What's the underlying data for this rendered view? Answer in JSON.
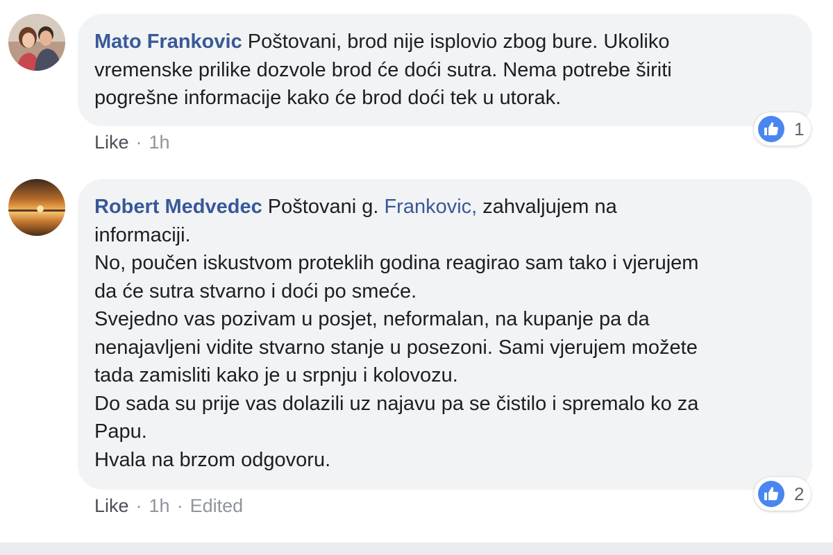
{
  "comments": [
    {
      "author": "Mato Frankovic",
      "lines": [
        "Poštovani, brod nije isplovio zbog bure. Ukoliko",
        "vremenske prilike dozvole brod će doći sutra. Nema potrebe širiti",
        "pogrešne informacije kako će brod doći tek u utorak."
      ],
      "like_label": "Like",
      "separator": "·",
      "time": "1h",
      "reaction_icon": "like-thumb-icon",
      "reaction_count": "1"
    },
    {
      "author": "Robert Medvedec",
      "first_line_pre": "Poštovani g.",
      "mention": "Frankovic,",
      "first_line_post": "zahvaljujem na",
      "lines": [
        "informaciji.",
        "No, poučen iskustvom proteklih godina reagirao sam tako i vjerujem",
        "da će sutra stvarno i doći po smeće.",
        "Svejedno vas pozivam u posjet, neformalan, na kupanje pa da",
        "nenajavljeni vidite stvarno stanje u posezoni. Sami vjerujem možete",
        "tada zamisliti kako je u srpnju i kolovozu.",
        "Do sada su prije vas dolazili uz najavu pa se čistilo i spremalo ko za",
        "Papu.",
        "Hvala na brzom odgovoru."
      ],
      "like_label": "Like",
      "separator": "·",
      "time": "1h",
      "edited_label": "Edited",
      "reaction_icon": "like-thumb-icon",
      "reaction_count": "2"
    }
  ],
  "colors": {
    "author": "#385898",
    "bubble": "#f2f3f5",
    "like_badge": "#4a86f0",
    "meta": "#90949c"
  }
}
